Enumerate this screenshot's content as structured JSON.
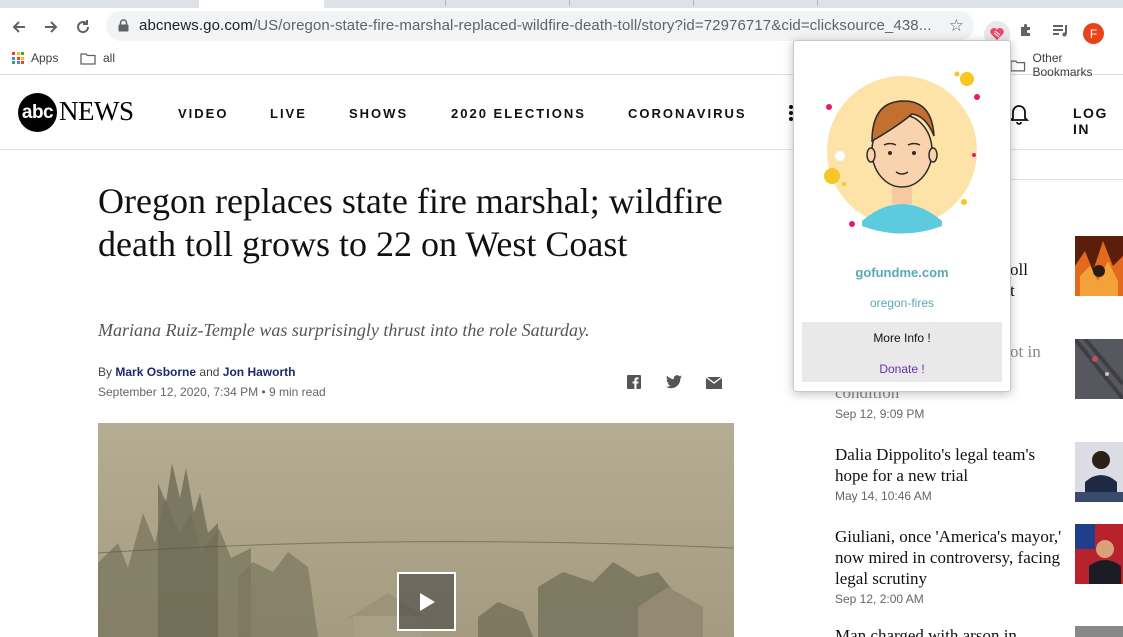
{
  "browser": {
    "url_host": "abcnews.go.com",
    "url_path": "/US/oregon-state-fire-marshal-replaced-wildfire-death-toll/story?id=72976717&cid=clicksource_438...",
    "profile_initial": "F"
  },
  "bookmarks": {
    "apps_label": "Apps",
    "folder_label": "all",
    "other_label": "Other Bookmarks"
  },
  "site": {
    "logo_abc": "abc",
    "logo_news": "NEWS",
    "nav": [
      "VIDEO",
      "LIVE",
      "SHOWS",
      "2020 ELECTIONS",
      "CORONAVIRUS"
    ],
    "login": "LOG IN"
  },
  "article": {
    "headline": "Oregon replaces state fire marshal; wildfire death toll grows to 22 on West Coast",
    "subhead": "Mariana Ruiz-Temple was surprisingly thrust into the role Saturday.",
    "by_prefix": "By",
    "author1": "Mark Osborne",
    "and": "and",
    "author2": "Jon Haworth",
    "date": "September 12, 2020, 7:34 PM",
    "read_time": "• 9 min read"
  },
  "sidebar": {
    "items": [
      {
        "title_fragment_1": "oll",
        "title_fragment_2": "t"
      },
      {
        "title_fragment_1": "ot in",
        "title_fragment_2": "condition",
        "date": "Sep 12, 9:09 PM"
      },
      {
        "title": "Dalia Dippolito's legal team's hope for a new trial",
        "date": "May 14, 10:46 AM"
      },
      {
        "title": "Giuliani, once 'America's mayor,' now mired in controversy, facing legal scrutiny",
        "date": "Sep 12, 2:00 AM"
      },
      {
        "title": "Man charged with arson in"
      }
    ]
  },
  "popup": {
    "site": "gofundme.com",
    "slug": "oregon-fires",
    "more_info": "More Info !",
    "donate": "Donate !"
  },
  "colors": {
    "brand_teal": "#5aa8b6",
    "donate_purple": "#6b2fb3",
    "author_blue": "#1a2a6c"
  }
}
